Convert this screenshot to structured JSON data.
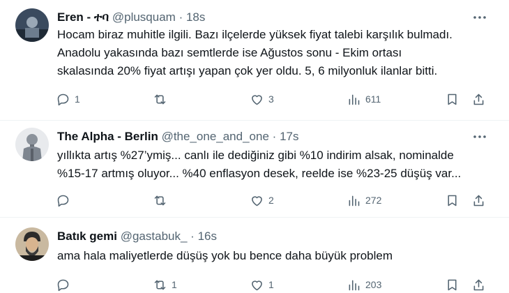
{
  "tweets": [
    {
      "name": "Eren - ተባ",
      "handle": "@plusquam",
      "dot": "·",
      "time": "18s",
      "lines": [
        "Hocam biraz muhitle ilgili. Bazı ilçelerde yüksek fiyat talebi karşılık bulmadı.",
        "Anadolu yakasında bazı semtlerde ise Ağustos sonu - Ekim ortası",
        "skalasında 20% fiyat artışı yapan çok yer oldu. 5, 6 milyonluk ilanlar bitti."
      ],
      "replies": "1",
      "retweets": "",
      "likes": "3",
      "views": "611"
    },
    {
      "name": "The Alpha - Berlin",
      "handle": "@the_one_and_one",
      "dot": "·",
      "time": "17s",
      "lines": [
        "yıllıkta artış %27’ymiş... canlı ile dediğiniz gibi %10 indirim alsak, nominalde",
        "%15-17 artmış oluyor...  %40 enflasyon desek, reelde ise %23-25 düşüş var..."
      ],
      "replies": "",
      "retweets": "",
      "likes": "2",
      "views": "272"
    },
    {
      "name": "Batık gemi",
      "handle": "@gastabuk_",
      "dot": "·",
      "time": "16s",
      "lines": [
        "ama hala maliyetlerde düşüş yok bu bence daha büyük problem"
      ],
      "replies": "",
      "retweets": "1",
      "likes": "1",
      "views": "203"
    }
  ],
  "icons": {
    "reply": "reply-icon",
    "retweet": "retweet-icon",
    "like": "like-icon",
    "views": "views-icon",
    "bookmark": "bookmark-icon",
    "share": "share-icon",
    "more": "more-icon"
  },
  "colors": {
    "text": "#0f1419",
    "secondary": "#536471",
    "divider": "#eff3f4"
  }
}
